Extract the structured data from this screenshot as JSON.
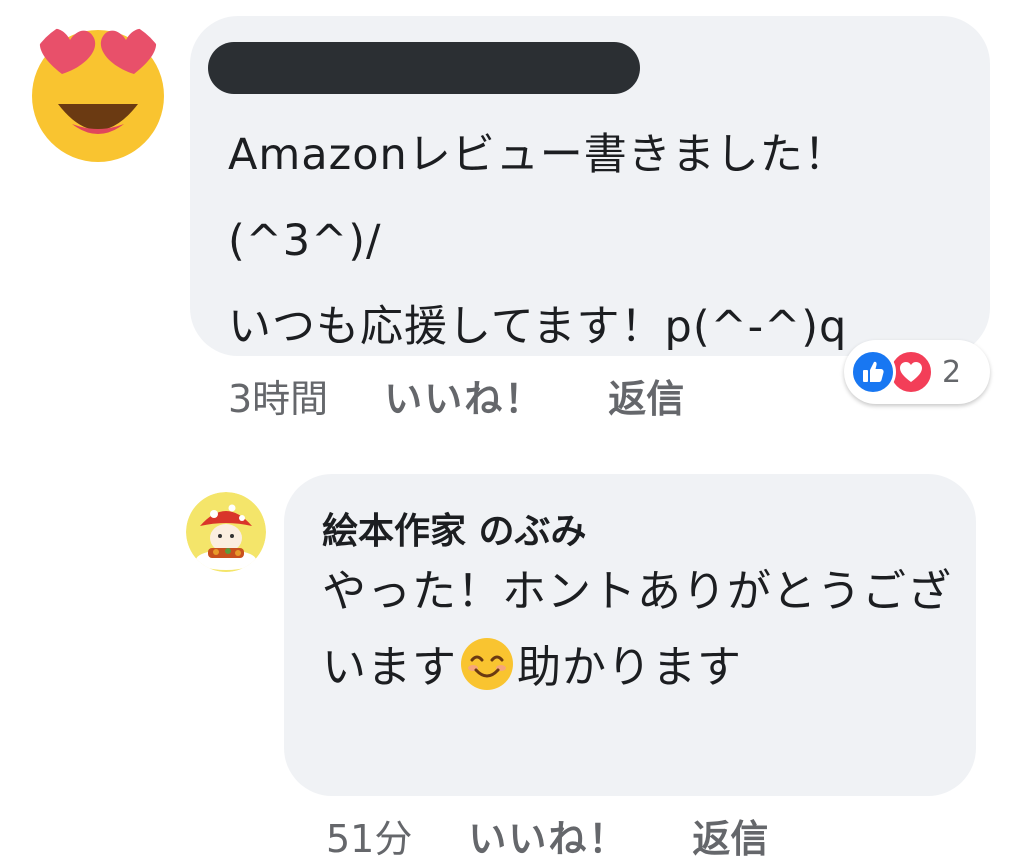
{
  "comments": [
    {
      "avatar_icon": "heart-eyes-emoji-icon",
      "author_redacted": true,
      "text": "Amazonレビュー書きました！(^3^)/\nいつも応援してます！p(^-^)q",
      "time": "3時間",
      "like_label": "いいね！",
      "reply_label": "返信",
      "reactions": {
        "icons": [
          "like-reaction-icon",
          "love-reaction-icon"
        ],
        "count": "2"
      }
    },
    {
      "avatar_icon": "mushroom-character-avatar",
      "author": "絵本作家 のぶみ",
      "text_before": "やった！ホントありがとうございます",
      "inline_emoji": "smiling-face-emoji-icon",
      "text_after": "助かります",
      "time": "51分",
      "like_label": "いいね！",
      "reply_label": "返信"
    }
  ],
  "colors": {
    "bubble": "#f0f2f5",
    "meta_text": "#65676b",
    "like_blue": "#1877f2",
    "love_red": "#f33e58"
  }
}
